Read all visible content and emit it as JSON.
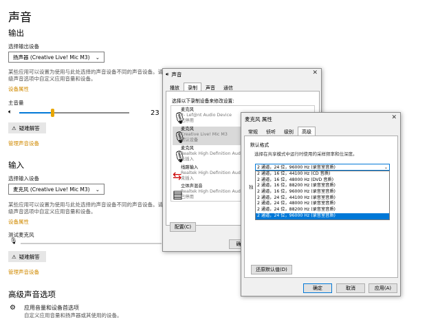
{
  "settings": {
    "title": "声音",
    "output": {
      "heading": "输出",
      "select_label": "选择输出设备",
      "device": "扬声器 (Creative Live! Mic M3)",
      "desc_line1": "某些应用可以设置为使用与此处选择的声音设备不同的声音设备。请在高",
      "desc_line2": "级声音选项中自定义应用音量和设备。",
      "properties_link": "设备属性",
      "volume_label": "主音量",
      "volume_value": "23",
      "volume_level": 0.3,
      "troubleshoot": "疑难解答",
      "manage_link": "管理声音设备"
    },
    "input": {
      "heading": "输入",
      "select_label": "选择输入设备",
      "device": "麦克风 (Creative Live! Mic M3)",
      "desc_line1": "某些应用可以设置为使用与此处选择的声音设备不同的声音设备。请在高",
      "desc_line2": "级声音选项中自定义应用音量和设备。",
      "properties_link": "设备属性",
      "test_label": "测试麦克风",
      "troubleshoot": "疑难解答",
      "manage_link": "管理声音设备"
    },
    "advanced": {
      "heading": "高级声音选项",
      "app_volume_title": "应用音量和设备首选项",
      "app_volume_desc": "自定义应用音量和扬声器或其使用的设备。"
    }
  },
  "sound_dialog": {
    "title": "声音",
    "tabs": [
      "播放",
      "录制",
      "声音",
      "通信"
    ],
    "instruction": "选择以下录制设备来修改设置:",
    "devices": [
      {
        "name": "麦克风",
        "line2": "2- Lef@nt Audio Device",
        "status": "已停用"
      },
      {
        "name": "麦克风",
        "line2": "Creative Live! Mic M3",
        "status": "默认设备"
      },
      {
        "name": "麦克风",
        "line2": "Realtek High Definition Audio",
        "status": "未插入"
      },
      {
        "name": "线路输入",
        "line2": "Realtek High Definition Audio",
        "status": "未插入"
      },
      {
        "name": "立体声混音",
        "line2": "Realtek High Definition Audio",
        "status": "已停用"
      }
    ],
    "configure": "配置(C)",
    "ok_partial": "确"
  },
  "props_dialog": {
    "title": "麦克风 属性",
    "tabs": [
      "常规",
      "侦听",
      "级别",
      "高级"
    ],
    "group_label": "默认格式",
    "instruction": "选择在共享模式中运行时使用的采样频率和位深度。",
    "selected": "2 通道，24 位，96000 Hz (录音室音质)",
    "options": [
      "2 通道，16 位，44100 Hz (CD 音质)",
      "2 通道，16 位，48000 Hz (DVD 音质)",
      "2 通道，16 位，88200 Hz (录音室音质)",
      "2 通道，16 位，96000 Hz (录音室音质)",
      "2 通道，24 位，44100 Hz (录音室音质)",
      "2 通道，24 位，48000 Hz (录音室音质)",
      "2 通道，24 位，88200 Hz (录音室音质)",
      "2 通道，24 位，96000 Hz (录音室音质)"
    ],
    "selected_index": 7,
    "side_partial": "独",
    "restore": "还原默认值(D)",
    "ok": "确定",
    "cancel": "取消",
    "apply": "应用(A)"
  },
  "colors": {
    "accent": "#0078d7",
    "link": "#d08a00"
  }
}
